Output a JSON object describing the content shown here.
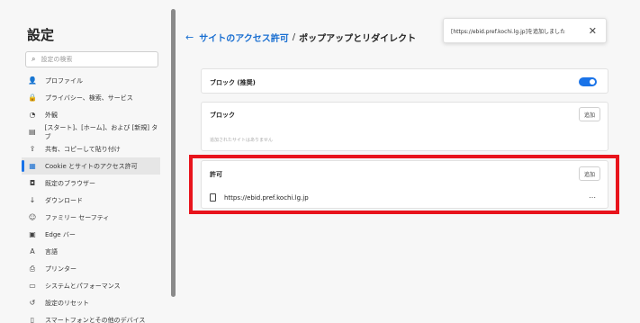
{
  "sidebar": {
    "title": "設定",
    "search_placeholder": "設定の検索",
    "items": [
      {
        "icon": "👤",
        "label": "プロファイル",
        "active": false
      },
      {
        "icon": "🔒",
        "label": "プライバシー、検索、サービス",
        "active": false
      },
      {
        "icon": "◔",
        "label": "外観",
        "active": false
      },
      {
        "icon": "▤",
        "label": "[スタート]、[ホーム]、および [新規] タブ",
        "active": false
      },
      {
        "icon": "⇪",
        "label": "共有、コピーして貼り付け",
        "active": false
      },
      {
        "icon": "▦",
        "label": "Cookie とサイトのアクセス許可",
        "active": true
      },
      {
        "icon": "◘",
        "label": "既定のブラウザー",
        "active": false
      },
      {
        "icon": "↓",
        "label": "ダウンロード",
        "active": false
      },
      {
        "icon": "☺",
        "label": "ファミリー セーフティ",
        "active": false
      },
      {
        "icon": "▣",
        "label": "Edge バー",
        "active": false
      },
      {
        "icon": "A",
        "label": "言語",
        "active": false
      },
      {
        "icon": "⎙",
        "label": "プリンター",
        "active": false
      },
      {
        "icon": "▭",
        "label": "システムとパフォーマンス",
        "active": false
      },
      {
        "icon": "↺",
        "label": "設定のリセット",
        "active": false
      },
      {
        "icon": "▯",
        "label": "スマートフォンとその他のデバイス",
        "active": false
      }
    ]
  },
  "header": {
    "back_icon": "←",
    "crumb_link": "サイトのアクセス許可",
    "separator": "/",
    "current": "ポップアップとリダイレクト"
  },
  "toast": {
    "message": "[https://ebid.pref.kochi.lg.jp]を追加しました",
    "close_icon": "✕"
  },
  "block_setting": {
    "label": "ブロック (推奨)",
    "enabled": true
  },
  "block_section": {
    "label": "ブロック",
    "add_label": "追加",
    "empty_text": "追加されたサイトはありません"
  },
  "allow_section": {
    "label": "許可",
    "add_label": "追加",
    "sites": [
      "https://ebid.pref.kochi.lg.jp"
    ],
    "more_icon": "⋯"
  },
  "colors": {
    "accent": "#1a73e8",
    "highlight": "#e8141c"
  }
}
